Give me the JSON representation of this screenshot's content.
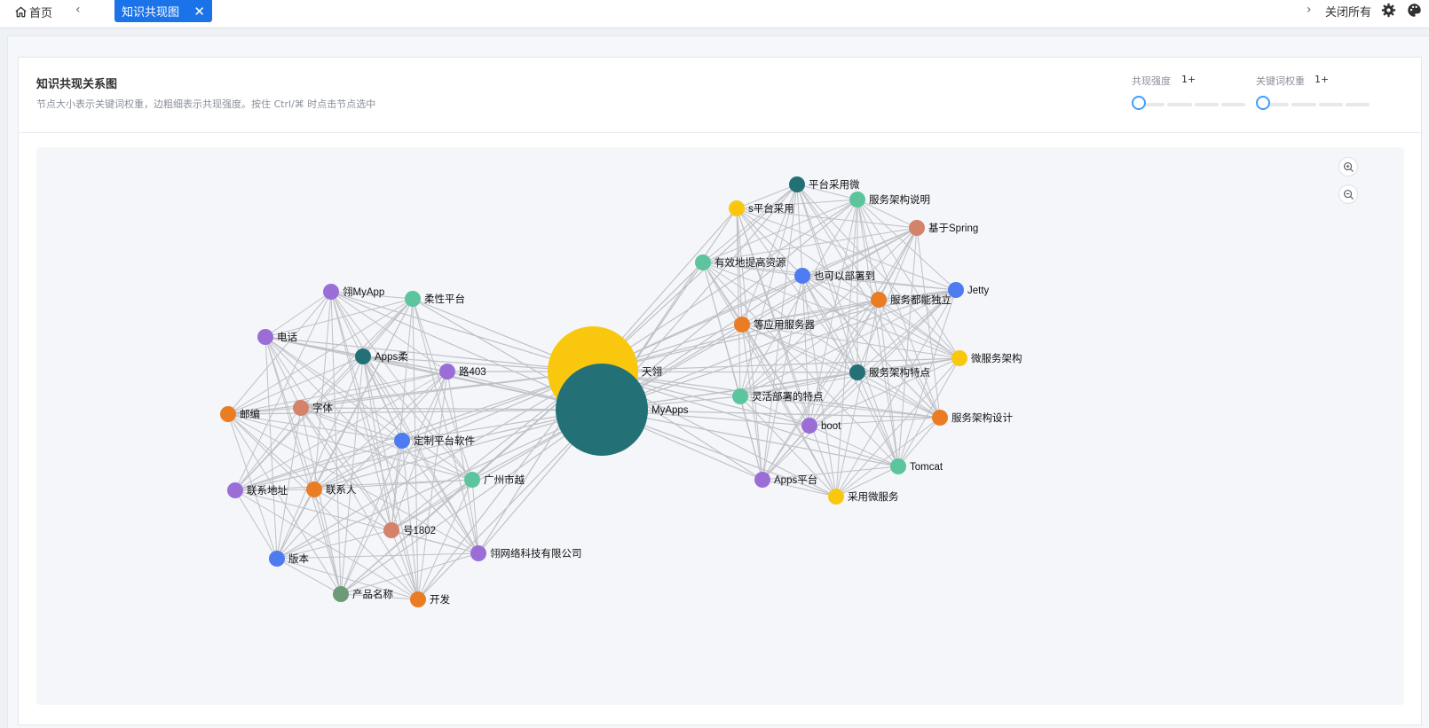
{
  "topbar": {
    "home_label": "首页",
    "active_tab": "知识共现图",
    "close_all": "关闭所有"
  },
  "card": {
    "title": "知识共现关系图",
    "subtitle": "节点大小表示关键词权重，边粗细表示共现强度。按住 Ctrl/⌘ 时点击节点选中"
  },
  "filters": {
    "cooccurrence_label": "共现强度",
    "cooccurrence_value": "1+",
    "weight_label": "关键词权重",
    "weight_value": "1+"
  },
  "colors": {
    "yellow": "#f9c80e",
    "teal": "#237077",
    "green": "#5cc59e",
    "orange": "#ea7c24",
    "purple": "#9b6ed7",
    "blue": "#4f7bf0",
    "salmon": "#d4826a",
    "sage": "#6e9b77",
    "edge": "#bfc1c6"
  },
  "graph": {
    "nodes": [
      {
        "id": "tianxiang",
        "label": "天翎",
        "color": "yellow",
        "r": 51
      },
      {
        "id": "myapps",
        "label": "MyApps",
        "color": "teal",
        "r": 52
      },
      {
        "id": "n1",
        "label": "翎MyApp",
        "color": "purple",
        "r": 9
      },
      {
        "id": "n2",
        "label": "柔性平台",
        "color": "green",
        "r": 9
      },
      {
        "id": "n3",
        "label": "电话",
        "color": "purple",
        "r": 9
      },
      {
        "id": "n4",
        "label": "Apps柔",
        "color": "teal",
        "r": 9
      },
      {
        "id": "n5",
        "label": "路403",
        "color": "purple",
        "r": 9
      },
      {
        "id": "n6",
        "label": "邮编",
        "color": "orange",
        "r": 9
      },
      {
        "id": "n7",
        "label": "字体",
        "color": "salmon",
        "r": 9
      },
      {
        "id": "n8",
        "label": "定制平台软件",
        "color": "blue",
        "r": 9
      },
      {
        "id": "n9",
        "label": "联系地址",
        "color": "purple",
        "r": 9
      },
      {
        "id": "n10",
        "label": "联系人",
        "color": "orange",
        "r": 9
      },
      {
        "id": "n11",
        "label": "广州市越",
        "color": "green",
        "r": 9
      },
      {
        "id": "n12",
        "label": "号1802",
        "color": "salmon",
        "r": 9
      },
      {
        "id": "n13",
        "label": "翎网络科技有限公司",
        "color": "purple",
        "r": 9
      },
      {
        "id": "n14",
        "label": "版本",
        "color": "blue",
        "r": 9
      },
      {
        "id": "n15",
        "label": "产品名称",
        "color": "sage",
        "r": 9
      },
      {
        "id": "n16",
        "label": "开发",
        "color": "orange",
        "r": 9
      },
      {
        "id": "m1",
        "label": "平台采用微",
        "color": "teal",
        "r": 9
      },
      {
        "id": "m2",
        "label": "s平台采用",
        "color": "yellow",
        "r": 9
      },
      {
        "id": "m3",
        "label": "服务架构说明",
        "color": "green",
        "r": 9
      },
      {
        "id": "m4",
        "label": "基于Spring",
        "color": "salmon",
        "r": 9
      },
      {
        "id": "m5",
        "label": "有效地提高资源",
        "color": "green",
        "r": 9
      },
      {
        "id": "m6",
        "label": "也可以部署到",
        "color": "blue",
        "r": 9
      },
      {
        "id": "m7",
        "label": "Jetty",
        "color": "blue",
        "r": 9
      },
      {
        "id": "m8",
        "label": "服务都能独立",
        "color": "orange",
        "r": 9
      },
      {
        "id": "m9",
        "label": "等应用服务器",
        "color": "orange",
        "r": 9
      },
      {
        "id": "m10",
        "label": "微服务架构",
        "color": "yellow",
        "r": 9
      },
      {
        "id": "m11",
        "label": "服务架构特点",
        "color": "teal",
        "r": 9
      },
      {
        "id": "m12",
        "label": "灵活部署的特点",
        "color": "green",
        "r": 9
      },
      {
        "id": "m13",
        "label": "服务架构设计",
        "color": "orange",
        "r": 9
      },
      {
        "id": "m14",
        "label": "boot",
        "color": "purple",
        "r": 9
      },
      {
        "id": "m15",
        "label": "Tomcat",
        "color": "green",
        "r": 9
      },
      {
        "id": "m16",
        "label": "Apps平台",
        "color": "purple",
        "r": 9
      },
      {
        "id": "m17",
        "label": "采用微服务",
        "color": "yellow",
        "r": 9
      }
    ]
  }
}
